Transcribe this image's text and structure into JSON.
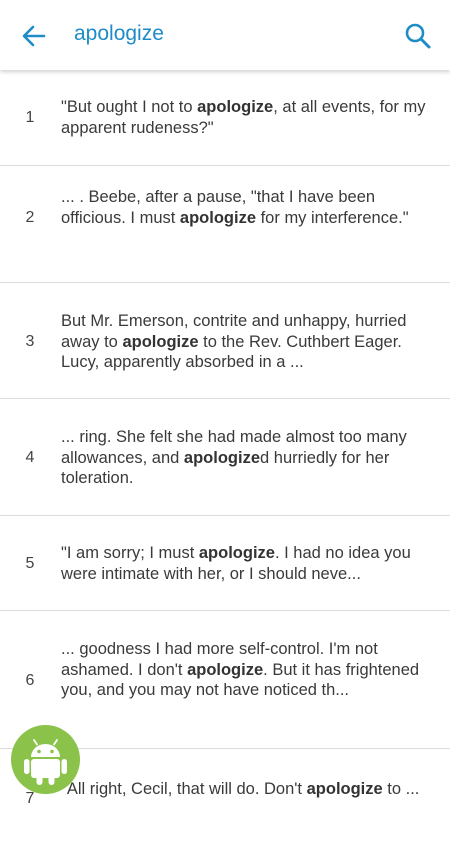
{
  "appbar": {
    "title": "apologize",
    "back_icon": "arrow-left-icon",
    "search_icon": "search-icon",
    "accent_color": "#1e8cc6"
  },
  "results": [
    {
      "num": "1",
      "text_html": "\"But ought I not to <b>apologize</b>, at all events, for my apparent rudeness?\""
    },
    {
      "num": "2",
      "text_html": "... . Beebe, after a pause, \"that I have been officious. I must <b>apologize</b> for my interference.\""
    },
    {
      "num": "3",
      "text_html": "But Mr. Emerson, contrite and unhappy, hurried away to <b>apologize</b> to the Rev. Cuthbert Eager. Lucy, apparently absorbed in a ..."
    },
    {
      "num": "4",
      "text_html": "... ring. She felt she had made almost too many allowances, and <b>apologize</b>d hurriedly for her toleration."
    },
    {
      "num": "5",
      "text_html": "\"I am sorry; I must <b>apologize</b>. I had no idea you were intimate with her, or I should neve..."
    },
    {
      "num": "6",
      "text_html": "... goodness I had more self-control. I'm not ashamed. I don't <b>apologize</b>. But it has frightened you, and you may not have noticed th..."
    },
    {
      "num": "7",
      "text_html": "\"All right, Cecil, that will do. Don't <b>apologize</b> to ..."
    }
  ],
  "fab": {
    "icon": "android-robot-icon",
    "color": "#8bc34a"
  }
}
